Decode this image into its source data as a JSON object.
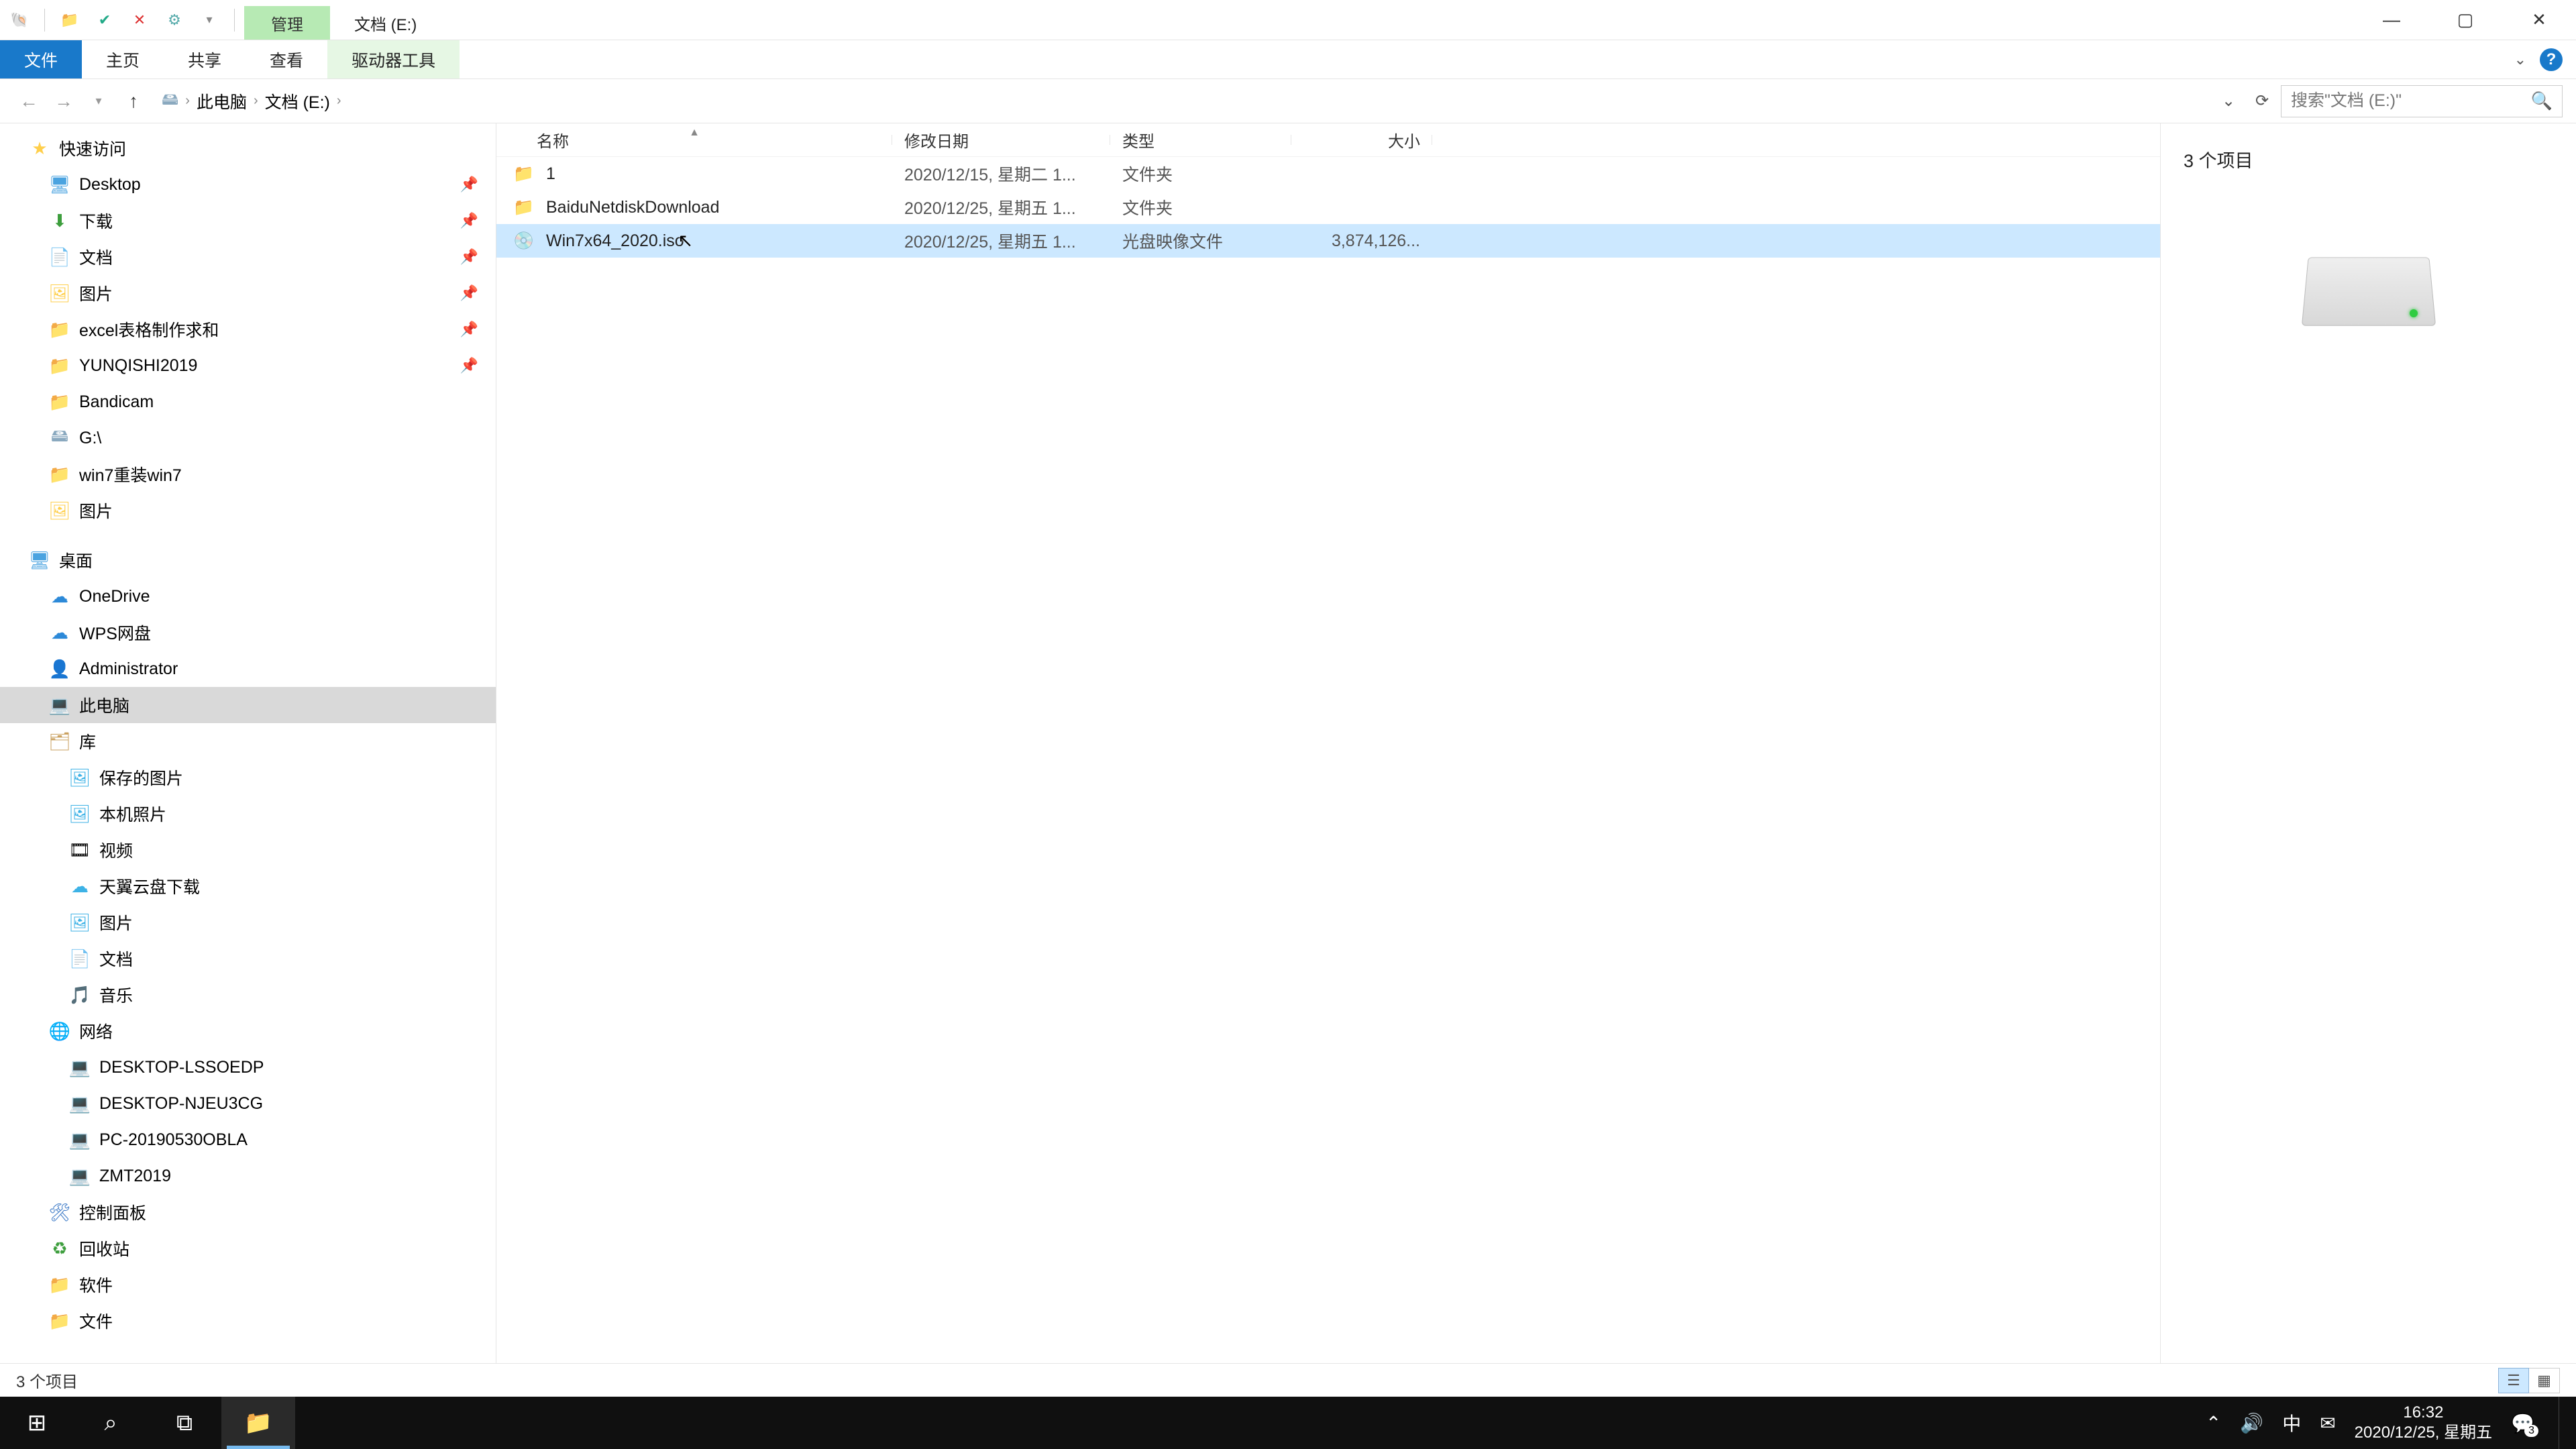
{
  "titlebar": {
    "context_tab": "管理",
    "title": "文档 (E:)"
  },
  "ribbon": {
    "file": "文件",
    "home": "主页",
    "share": "共享",
    "view": "查看",
    "drive_tools": "驱动器工具"
  },
  "breadcrumb": {
    "pc": "此电脑",
    "drive": "文档 (E:)"
  },
  "search": {
    "placeholder": "搜索\"文档 (E:)\""
  },
  "columns": {
    "name": "名称",
    "date": "修改日期",
    "type": "类型",
    "size": "大小"
  },
  "files": [
    {
      "name": "1",
      "date": "2020/12/15, 星期二 1...",
      "type": "文件夹",
      "size": "",
      "icon": "folder",
      "selected": false
    },
    {
      "name": "BaiduNetdiskDownload",
      "date": "2020/12/25, 星期五 1...",
      "type": "文件夹",
      "size": "",
      "icon": "folder",
      "selected": false
    },
    {
      "name": "Win7x64_2020.iso",
      "date": "2020/12/25, 星期五 1...",
      "type": "光盘映像文件",
      "size": "3,874,126...",
      "icon": "disc",
      "selected": true
    }
  ],
  "sidebar": {
    "quick_access": "快速访问",
    "desktop": "Desktop",
    "downloads": "下载",
    "documents": "文档",
    "pictures": "图片",
    "excel": "excel表格制作求和",
    "yunqishi": "YUNQISHI2019",
    "bandicam": "Bandicam",
    "g_drive": "G:\\",
    "win7": "win7重装win7",
    "pictures2": "图片",
    "desktop_group": "桌面",
    "onedrive": "OneDrive",
    "wps": "WPS网盘",
    "administrator": "Administrator",
    "this_pc": "此电脑",
    "libraries": "库",
    "saved_pics": "保存的图片",
    "camera_roll": "本机照片",
    "videos": "视频",
    "tianyi": "天翼云盘下载",
    "lib_pictures": "图片",
    "lib_documents": "文档",
    "music": "音乐",
    "network": "网络",
    "pc1": "DESKTOP-LSSOEDP",
    "pc2": "DESKTOP-NJEU3CG",
    "pc3": "PC-20190530OBLA",
    "pc4": "ZMT2019",
    "control_panel": "控制面板",
    "recycle": "回收站",
    "software": "软件",
    "files_folder": "文件"
  },
  "details": {
    "summary": "3 个项目"
  },
  "statusbar": {
    "text": "3 个项目"
  },
  "taskbar": {
    "time": "16:32",
    "date": "2020/12/25, 星期五",
    "ime": "中",
    "notif_count": "3"
  }
}
